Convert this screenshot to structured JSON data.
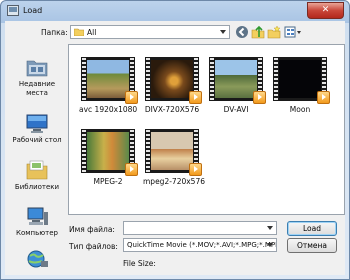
{
  "window": {
    "title": "Load",
    "close_glyph": "✕"
  },
  "toolbar": {
    "folder_label": "Папка:",
    "folder_value": "All",
    "icons": [
      "back-icon",
      "up-folder-icon",
      "new-folder-icon",
      "view-menu-icon"
    ]
  },
  "places": [
    {
      "label": "Недавние места",
      "icon": "recent-places-icon"
    },
    {
      "label": "Рабочий стол",
      "icon": "desktop-icon"
    },
    {
      "label": "Библиотеки",
      "icon": "libraries-icon"
    },
    {
      "label": "Компьютер",
      "icon": "computer-icon"
    },
    {
      "label": "",
      "icon": "network-icon"
    }
  ],
  "files": [
    {
      "name": "avc 1920x1080"
    },
    {
      "name": "DIVX-720X576"
    },
    {
      "name": "DV-AVI"
    },
    {
      "name": "Moon"
    },
    {
      "name": "MPEG-2"
    },
    {
      "name": "mpeg2-720x576"
    }
  ],
  "form": {
    "filename_label": "Имя файла:",
    "filename_value": "",
    "filetype_label": "Тип файлов:",
    "filetype_value": "QuickTime Movie (*.MOV;*.AVI;*.MPG;*.MPEG",
    "filesize_label": "File Size:"
  },
  "buttons": {
    "load": "Load",
    "cancel": "Отмена"
  }
}
